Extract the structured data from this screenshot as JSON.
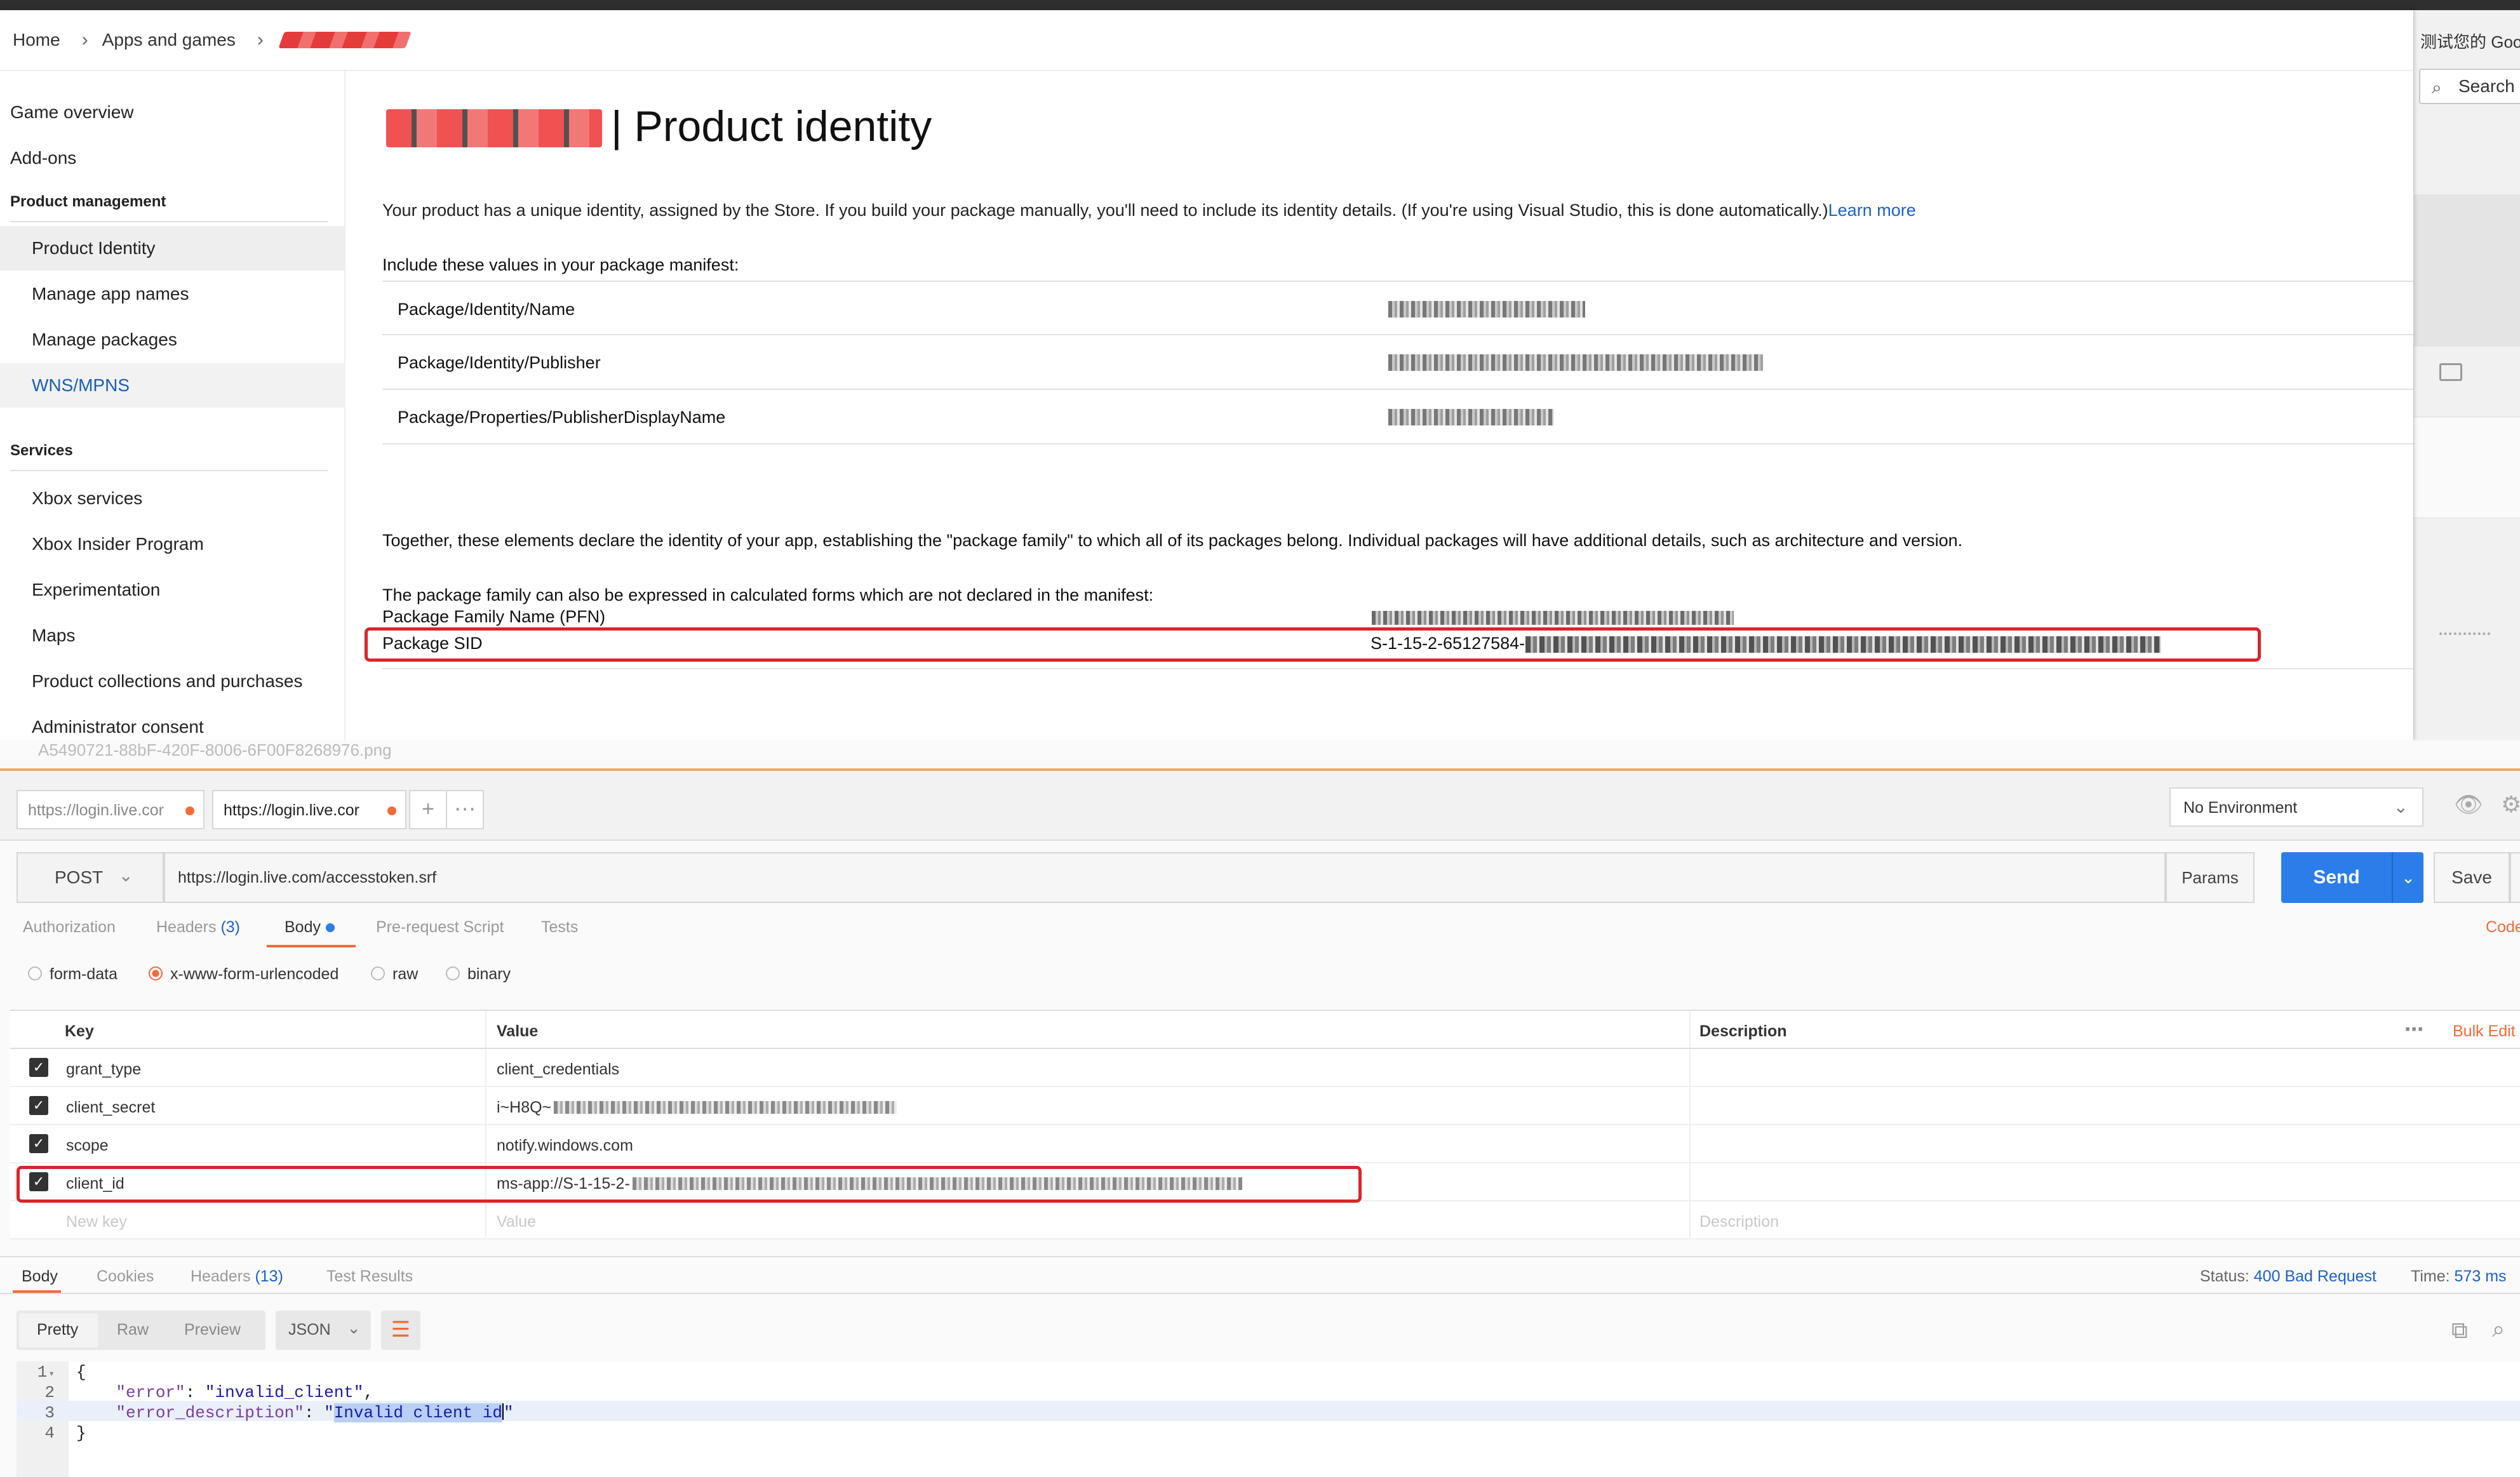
{
  "browser_bg": {
    "tab_text": "测试您的 Goog",
    "search_placeholder": "Search"
  },
  "partner_center": {
    "breadcrumb": [
      "Home",
      "Apps and games"
    ],
    "sidebar": {
      "top_items": [
        "Game overview",
        "Add-ons"
      ],
      "section_product": "Product management",
      "product_items": [
        "Product Identity",
        "Manage app names",
        "Manage packages",
        "WNS/MPNS"
      ],
      "section_services": "Services",
      "service_items": [
        "Xbox services",
        "Xbox Insider Program",
        "Experimentation",
        "Maps",
        "Product collections and purchases",
        "Administrator consent"
      ]
    },
    "title": "| Product identity",
    "intro": "Your product has a unique identity, assigned by the Store. If you build your package manually, you'll need to include its identity details. (If you're using Visual Studio, this is done automatically.)",
    "learn_more": "Learn more",
    "include_label": "Include these values in your package manifest:",
    "identity_rows": [
      "Package/Identity/Name",
      "Package/Identity/Publisher",
      "Package/Properties/PublisherDisplayName"
    ],
    "together_text": "Together, these elements declare the identity of your app, establishing the \"package family\" to which all of its packages belong. Individual packages will have additional details, such as architecture and version.",
    "family_text": "The package family can also be expressed in calculated forms which are not declared in the manifest:",
    "pfn_label": "Package Family Name (PFN)",
    "sid_label": "Package SID",
    "sid_value_prefix": "S-1-15-2-65127584-"
  },
  "postman": {
    "ghost_text": "A5490721-88bF-420F-8006-6F00F8268976.png",
    "tabs": [
      "https://login.live.cor",
      "https://login.live.cor"
    ],
    "environment": "No Environment",
    "method": "POST",
    "url": "https://login.live.com/accesstoken.srf",
    "params_label": "Params",
    "send_label": "Send",
    "save_label": "Save",
    "request_tabs": {
      "authorization": "Authorization",
      "headers": "Headers",
      "headers_count": "(3)",
      "body": "Body",
      "prerequest": "Pre-request Script",
      "tests": "Tests",
      "code": "Code"
    },
    "body_types": [
      "form-data",
      "x-www-form-urlencoded",
      "raw",
      "binary"
    ],
    "kv_headers": {
      "key": "Key",
      "value": "Value",
      "description": "Description",
      "bulk_edit": "Bulk Edit"
    },
    "kv_rows": [
      {
        "key": "grant_type",
        "value": "client_credentials"
      },
      {
        "key": "client_secret",
        "value": "i~H8Q~"
      },
      {
        "key": "scope",
        "value": "notify.windows.com"
      },
      {
        "key": "client_id",
        "value": "ms-app://S-1-15-2-"
      }
    ],
    "kv_placeholders": {
      "key": "New key",
      "value": "Value",
      "description": "Description"
    },
    "response_tabs": {
      "body": "Body",
      "cookies": "Cookies",
      "headers": "Headers",
      "headers_count": "(13)",
      "test_results": "Test Results"
    },
    "status_label": "Status:",
    "status_value": "400 Bad Request",
    "time_label": "Time:",
    "time_value": "573 ms",
    "view_modes": [
      "Pretty",
      "Raw",
      "Preview"
    ],
    "format": "JSON",
    "code_lines": {
      "l1": "{",
      "l2_key": "\"error\"",
      "l2_val": "\"invalid_client\"",
      "l3_key": "\"error_description\"",
      "l3_val": "Invalid client id",
      "l4": "}"
    },
    "line_numbers": [
      "1",
      "2",
      "3",
      "4"
    ]
  }
}
